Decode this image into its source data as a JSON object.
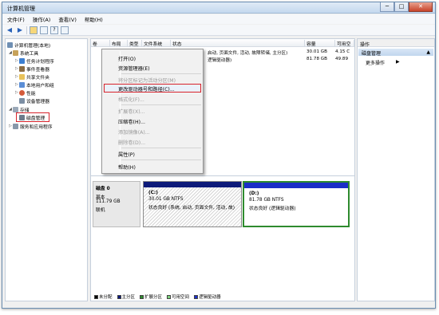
{
  "window": {
    "title": "计算机管理",
    "controls": [
      "─",
      "□",
      "✕"
    ]
  },
  "menu": [
    "文件(F)",
    "操作(A)",
    "查看(V)",
    "帮助(H)"
  ],
  "tree": {
    "root": "计算机管理(本地)",
    "system_tools": "系统工具",
    "task_scheduler": "任务计划程序",
    "event_viewer": "事件查看器",
    "shared_folders": "共享文件夹",
    "local_users": "本地用户和组",
    "performance": "性能",
    "device_manager": "设备管理器",
    "storage": "存储",
    "disk_management": "磁盘管理",
    "services": "服务和应用程序"
  },
  "columns": [
    "卷",
    "布局",
    "类型",
    "文件系统",
    "状态",
    "容量",
    "可用空"
  ],
  "volume_rows": [
    {
      "status": "启动, 页面文件, 活动, 故障转储, 主分区)",
      "capacity": "30.01 GB",
      "free": "4.15 C"
    },
    {
      "status": "逻辑驱动器)",
      "capacity": "81.78 GB",
      "free": "49.89"
    }
  ],
  "context_menu": {
    "open": "打开(O)",
    "explore": "资源管理器(E)",
    "mark_active": "将分区标记为活动分区(M)",
    "change_letter": "更改驱动器号和路径(C)...",
    "format": "格式化(F)...",
    "extend": "扩展卷(X)...",
    "shrink": "压缩卷(H)...",
    "add_mirror": "添加镜像(A)...",
    "delete": "删除卷(D)...",
    "properties": "属性(P)",
    "help": "帮助(H)"
  },
  "disk": {
    "name": "磁盘 0",
    "type": "基本",
    "size": "111.79 GB",
    "status": "联机"
  },
  "partitions": {
    "c": {
      "label": "(C:)",
      "fs": "30.01 GB NTFS",
      "status": "状态良好 (系统, 启动, 页面文件, 活动, 故)"
    },
    "d": {
      "label": "(D:)",
      "fs": "81.78 GB NTFS",
      "status": "状态良好 (逻辑驱动器)"
    }
  },
  "legend": [
    {
      "label": "未分配",
      "color": "#000000"
    },
    {
      "label": "主分区",
      "color": "#0d1a7a"
    },
    {
      "label": "扩展分区",
      "color": "#2e8b2e"
    },
    {
      "label": "可用空间",
      "color": "#7ed37e"
    },
    {
      "label": "逻辑驱动器",
      "color": "#1a2ec7"
    }
  ],
  "actions": {
    "header": "操作",
    "selected": "磁盘管理",
    "more": "更多操作",
    "more_arrow": "▶",
    "selected_arrow": "▲"
  }
}
